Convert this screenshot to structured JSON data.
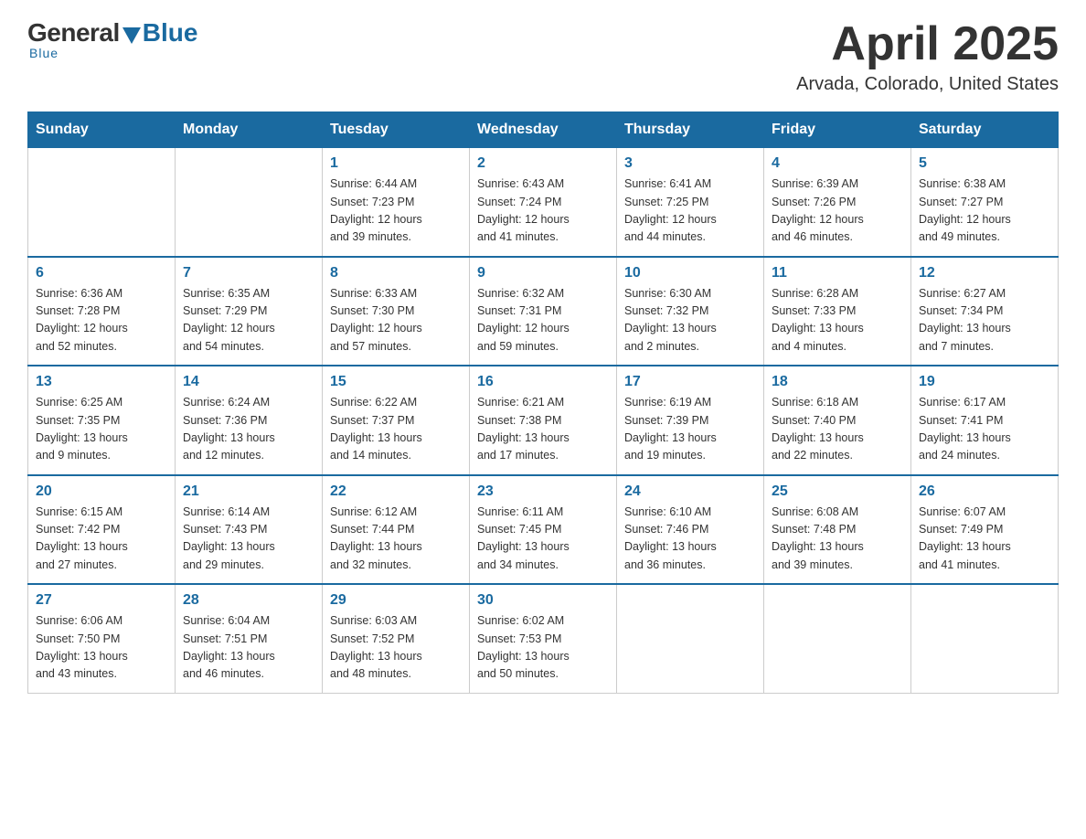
{
  "header": {
    "logo_general": "General",
    "logo_blue": "Blue",
    "month_year": "April 2025",
    "location": "Arvada, Colorado, United States"
  },
  "weekdays": [
    "Sunday",
    "Monday",
    "Tuesday",
    "Wednesday",
    "Thursday",
    "Friday",
    "Saturday"
  ],
  "weeks": [
    [
      {
        "day": "",
        "info": ""
      },
      {
        "day": "",
        "info": ""
      },
      {
        "day": "1",
        "info": "Sunrise: 6:44 AM\nSunset: 7:23 PM\nDaylight: 12 hours\nand 39 minutes."
      },
      {
        "day": "2",
        "info": "Sunrise: 6:43 AM\nSunset: 7:24 PM\nDaylight: 12 hours\nand 41 minutes."
      },
      {
        "day": "3",
        "info": "Sunrise: 6:41 AM\nSunset: 7:25 PM\nDaylight: 12 hours\nand 44 minutes."
      },
      {
        "day": "4",
        "info": "Sunrise: 6:39 AM\nSunset: 7:26 PM\nDaylight: 12 hours\nand 46 minutes."
      },
      {
        "day": "5",
        "info": "Sunrise: 6:38 AM\nSunset: 7:27 PM\nDaylight: 12 hours\nand 49 minutes."
      }
    ],
    [
      {
        "day": "6",
        "info": "Sunrise: 6:36 AM\nSunset: 7:28 PM\nDaylight: 12 hours\nand 52 minutes."
      },
      {
        "day": "7",
        "info": "Sunrise: 6:35 AM\nSunset: 7:29 PM\nDaylight: 12 hours\nand 54 minutes."
      },
      {
        "day": "8",
        "info": "Sunrise: 6:33 AM\nSunset: 7:30 PM\nDaylight: 12 hours\nand 57 minutes."
      },
      {
        "day": "9",
        "info": "Sunrise: 6:32 AM\nSunset: 7:31 PM\nDaylight: 12 hours\nand 59 minutes."
      },
      {
        "day": "10",
        "info": "Sunrise: 6:30 AM\nSunset: 7:32 PM\nDaylight: 13 hours\nand 2 minutes."
      },
      {
        "day": "11",
        "info": "Sunrise: 6:28 AM\nSunset: 7:33 PM\nDaylight: 13 hours\nand 4 minutes."
      },
      {
        "day": "12",
        "info": "Sunrise: 6:27 AM\nSunset: 7:34 PM\nDaylight: 13 hours\nand 7 minutes."
      }
    ],
    [
      {
        "day": "13",
        "info": "Sunrise: 6:25 AM\nSunset: 7:35 PM\nDaylight: 13 hours\nand 9 minutes."
      },
      {
        "day": "14",
        "info": "Sunrise: 6:24 AM\nSunset: 7:36 PM\nDaylight: 13 hours\nand 12 minutes."
      },
      {
        "day": "15",
        "info": "Sunrise: 6:22 AM\nSunset: 7:37 PM\nDaylight: 13 hours\nand 14 minutes."
      },
      {
        "day": "16",
        "info": "Sunrise: 6:21 AM\nSunset: 7:38 PM\nDaylight: 13 hours\nand 17 minutes."
      },
      {
        "day": "17",
        "info": "Sunrise: 6:19 AM\nSunset: 7:39 PM\nDaylight: 13 hours\nand 19 minutes."
      },
      {
        "day": "18",
        "info": "Sunrise: 6:18 AM\nSunset: 7:40 PM\nDaylight: 13 hours\nand 22 minutes."
      },
      {
        "day": "19",
        "info": "Sunrise: 6:17 AM\nSunset: 7:41 PM\nDaylight: 13 hours\nand 24 minutes."
      }
    ],
    [
      {
        "day": "20",
        "info": "Sunrise: 6:15 AM\nSunset: 7:42 PM\nDaylight: 13 hours\nand 27 minutes."
      },
      {
        "day": "21",
        "info": "Sunrise: 6:14 AM\nSunset: 7:43 PM\nDaylight: 13 hours\nand 29 minutes."
      },
      {
        "day": "22",
        "info": "Sunrise: 6:12 AM\nSunset: 7:44 PM\nDaylight: 13 hours\nand 32 minutes."
      },
      {
        "day": "23",
        "info": "Sunrise: 6:11 AM\nSunset: 7:45 PM\nDaylight: 13 hours\nand 34 minutes."
      },
      {
        "day": "24",
        "info": "Sunrise: 6:10 AM\nSunset: 7:46 PM\nDaylight: 13 hours\nand 36 minutes."
      },
      {
        "day": "25",
        "info": "Sunrise: 6:08 AM\nSunset: 7:48 PM\nDaylight: 13 hours\nand 39 minutes."
      },
      {
        "day": "26",
        "info": "Sunrise: 6:07 AM\nSunset: 7:49 PM\nDaylight: 13 hours\nand 41 minutes."
      }
    ],
    [
      {
        "day": "27",
        "info": "Sunrise: 6:06 AM\nSunset: 7:50 PM\nDaylight: 13 hours\nand 43 minutes."
      },
      {
        "day": "28",
        "info": "Sunrise: 6:04 AM\nSunset: 7:51 PM\nDaylight: 13 hours\nand 46 minutes."
      },
      {
        "day": "29",
        "info": "Sunrise: 6:03 AM\nSunset: 7:52 PM\nDaylight: 13 hours\nand 48 minutes."
      },
      {
        "day": "30",
        "info": "Sunrise: 6:02 AM\nSunset: 7:53 PM\nDaylight: 13 hours\nand 50 minutes."
      },
      {
        "day": "",
        "info": ""
      },
      {
        "day": "",
        "info": ""
      },
      {
        "day": "",
        "info": ""
      }
    ]
  ]
}
